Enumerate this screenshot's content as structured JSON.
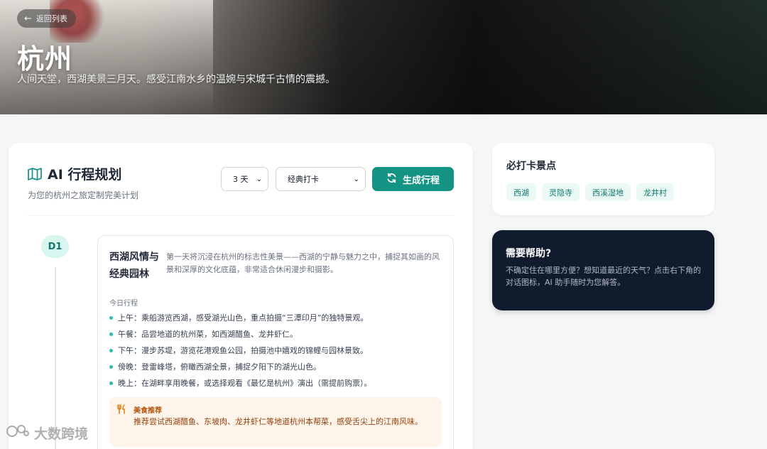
{
  "hero": {
    "back_label": "返回列表",
    "city_name": "杭州",
    "tagline": "人间天堂，西湖美景三月天。感受江南水乡的温婉与宋城千古情的震撼。"
  },
  "planner": {
    "title": "AI 行程规划",
    "subtitle": "为您的杭州之旅定制完美计划",
    "days_select": "3 天",
    "style_select": "经典打卡",
    "generate_label": "生成行程"
  },
  "day1": {
    "badge": "D1",
    "title": "西湖风情与经典园林",
    "description": "第一天将沉浸在杭州的标志性美景——西湖的宁静与魅力之中，捕捉其如画的风景和深厚的文化底蕴，非常适合休闲漫步和摄影。",
    "schedule_label": "今日行程",
    "schedule": [
      "上午：乘船游览西湖，感受湖光山色，重点拍摄“三潭印月”的独特景观。",
      "午餐：品尝地道的杭州菜，如西湖醋鱼、龙井虾仁。",
      "下午：漫步苏堤，游览花港观鱼公园，拍摄池中嬉戏的锦鲤与园林景致。",
      "傍晚：登雷峰塔，俯瞰西湖全景，捕捉夕阳下的湖光山色。",
      "晚上：在湖畔享用晚餐，或选择观看《最忆是杭州》演出（需提前购票）。"
    ],
    "food_title": "美食推荐",
    "food_text": "推荐尝试西湖醋鱼、东坡肉、龙井虾仁等地道杭州本帮菜，感受舌尖上的江南风味。"
  },
  "spots": {
    "title": "必打卡景点",
    "tags": [
      "西湖",
      "灵隐寺",
      "西溪湿地",
      "龙井村"
    ]
  },
  "help": {
    "title": "需要帮助?",
    "text": "不确定住在哪里方便？想知道最近的天气？点击右下角的对话图标，AI 助手随时为您解答。"
  },
  "watermark": "大数跨境",
  "colors": {
    "accent": "#149384",
    "help_bg": "#111b2e",
    "food_bg": "#fff5ea"
  }
}
